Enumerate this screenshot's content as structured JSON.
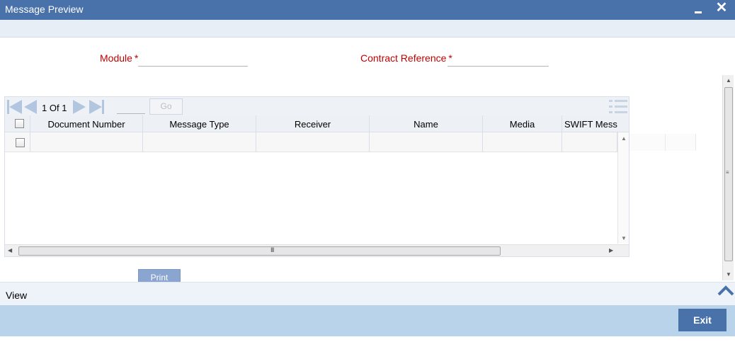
{
  "window": {
    "title": "Message Preview",
    "minimize_icon": "minimize-icon",
    "close_icon": "close-icon",
    "close_glyph": "✕"
  },
  "form": {
    "module_label": "Module",
    "module_value": "",
    "contract_reference_label": "Contract Reference",
    "contract_reference_value": "",
    "required_mark": "*"
  },
  "grid": {
    "pager": {
      "current": "1",
      "of_label": "Of",
      "total": "1",
      "page_input_value": "",
      "go_label": "Go"
    },
    "columns": [
      "Document Number",
      "Message Type",
      "Receiver",
      "Name",
      "Media",
      "SWIFT Mess"
    ],
    "rows": [
      {
        "cells": [
          "",
          "",
          "",
          "",
          "",
          ""
        ]
      }
    ],
    "scroll_grip": "III"
  },
  "actions": {
    "print_label": "Print"
  },
  "view_bar": {
    "label": "View"
  },
  "footer": {
    "exit_label": "Exit"
  },
  "colors": {
    "title_bar": "#4a72aa",
    "required_label": "#c00000",
    "footer_bar": "#b9d3ea",
    "accent_button": "#4a72aa"
  }
}
